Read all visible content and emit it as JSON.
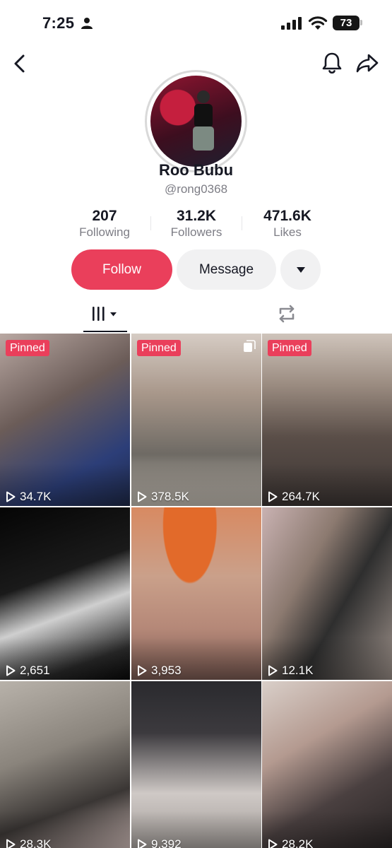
{
  "status": {
    "time": "7:25",
    "battery": "73"
  },
  "profile": {
    "display_name": "Roo Bubu",
    "username": "@rong0368",
    "stats": [
      {
        "value": "207",
        "label": "Following"
      },
      {
        "value": "31.2K",
        "label": "Followers"
      },
      {
        "value": "471.6K",
        "label": "Likes"
      }
    ]
  },
  "actions": {
    "follow_label": "Follow",
    "message_label": "Message"
  },
  "tabs": {
    "videos_icon": "grid-bars-icon",
    "reposts_icon": "repost-icon"
  },
  "videos": [
    {
      "views": "34.7K",
      "pinned_label": "Pinned"
    },
    {
      "views": "378.5K",
      "pinned_label": "Pinned"
    },
    {
      "views": "264.7K",
      "pinned_label": "Pinned"
    },
    {
      "views": "2,651"
    },
    {
      "views": "3,953"
    },
    {
      "views": "12.1K"
    },
    {
      "views": "28.3K"
    },
    {
      "views": "9,392"
    },
    {
      "views": "28.2K"
    }
  ],
  "colors": {
    "accent": "#ea3f5b",
    "secondary_button": "#f1f1f2",
    "muted_text": "#7d7d85"
  }
}
